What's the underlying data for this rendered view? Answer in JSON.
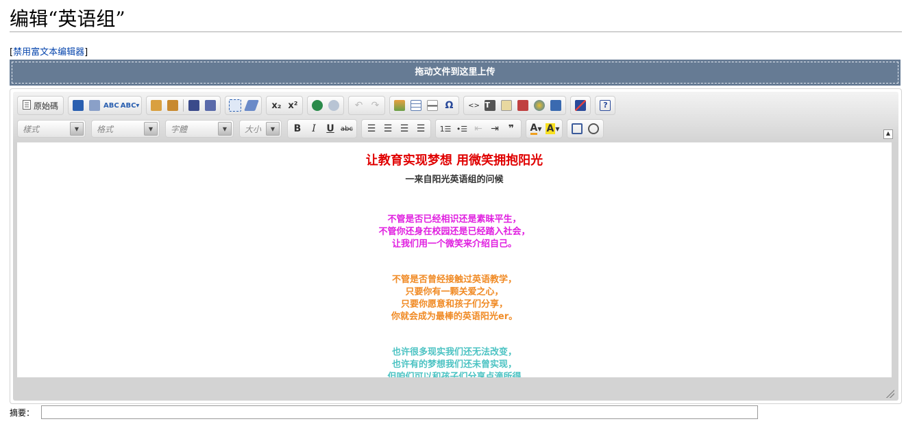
{
  "page": {
    "title": "编辑“英语组”"
  },
  "links": {
    "disable_rte_bracket_open": "[",
    "disable_rte": "禁用富文本编辑器",
    "disable_rte_bracket_close": "]"
  },
  "upload": {
    "label": "拖动文件到这里上传"
  },
  "toolbar": {
    "source_label": "原始碼",
    "style_combo": "樣式",
    "format_combo": "格式",
    "font_combo": "字體",
    "size_combo": "大小",
    "bold": "B",
    "italic": "I",
    "underline": "U",
    "strike": "abc",
    "subscript": "x₂",
    "superscript": "x²",
    "special_char": "Ω",
    "blockquote": "❞",
    "help": "?"
  },
  "content": {
    "headline": "让教育实现梦想 用微笑拥抱阳光",
    "subhead": "一来自阳光英语组的问候",
    "para1": [
      "不管是否已经相识还是素昧平生，",
      "不管你还身在校园还是已经踏入社会，",
      "让我们用一个微笑来介绍自己。"
    ],
    "para2": [
      "不管是否曾经接触过英语教学，",
      "只要你有一颗关爱之心，",
      "只要你愿意和孩子们分享，",
      "你就会成为最棒的英语阳光er。"
    ],
    "para3": [
      "也许很多现实我们还无法改变，",
      "也许有的梦想我们还未曾实现，",
      "但咱们可以和孩子们分享点滴所得"
    ]
  },
  "colors": {
    "headline": "#e00000",
    "para1": "#e020e0",
    "para2": "#f08a24",
    "para3": "#4cc3c3",
    "upload_bar": "#667b94"
  },
  "summary": {
    "label": "摘要：",
    "value": ""
  }
}
